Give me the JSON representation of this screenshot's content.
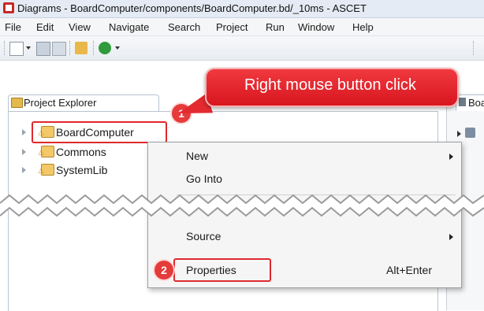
{
  "window": {
    "title": "Diagrams - BoardComputer/components/BoardComputer.bd/_10ms - ASCET"
  },
  "menubar": {
    "items": [
      "File",
      "Edit",
      "View",
      "Navigate",
      "Search",
      "Project",
      "Run",
      "Window",
      "Help"
    ]
  },
  "toolbar": {
    "icons": [
      "new-icon",
      "save-icon",
      "save-all-icon",
      "build-icon",
      "run-icon"
    ]
  },
  "explorer": {
    "tab_label": "Project Explorer",
    "tree": [
      {
        "label": "BoardComputer",
        "icon": "project-warning-icon"
      },
      {
        "label": "Commons",
        "icon": "project-warning-icon"
      },
      {
        "label": "SystemLib",
        "icon": "project-warning-icon"
      }
    ]
  },
  "right_tab": {
    "label": "Boa"
  },
  "callout": {
    "text": "Right mouse button click"
  },
  "badges": {
    "first": "1",
    "second": "2"
  },
  "context_menu": {
    "items": [
      {
        "label": "New",
        "submenu": true
      },
      {
        "label": "Go Into",
        "submenu": false
      },
      {
        "label": "Source",
        "submenu": true
      },
      {
        "label": "Properties",
        "shortcut": "Alt+Enter"
      }
    ]
  },
  "colors": {
    "highlight": "#e0282e",
    "callout": "#e32a30"
  }
}
